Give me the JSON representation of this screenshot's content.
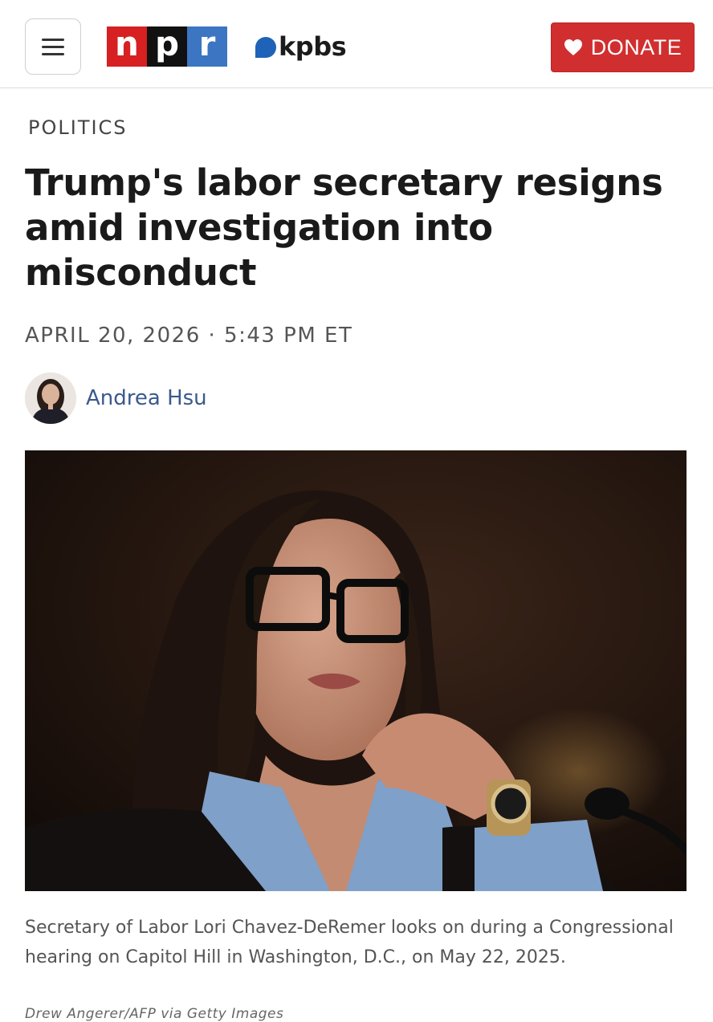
{
  "header": {
    "menu_icon": "hamburger-icon",
    "npr_logo": [
      "n",
      "p",
      "r"
    ],
    "station": "kpbs",
    "donate_label": "DONATE",
    "donate_icon": "heart-icon",
    "colors": {
      "npr_red": "#d62021",
      "npr_black": "#111111",
      "npr_blue": "#3c75c2",
      "donate_red": "#d12f2f",
      "kpbs_blue": "#1e63b8"
    }
  },
  "article": {
    "section": "POLITICS",
    "headline": "Trump's labor secretary resigns amid investigation into misconduct",
    "dateline": "APRIL 20, 2026 · 5:43 PM ET",
    "author": "Andrea Hsu",
    "caption": "Secretary of Labor Lori Chavez-DeRemer looks on during a Congressional hearing on Capitol Hill in Washington, D.C., on May 22, 2025.",
    "credit": "Drew Angerer/AFP via Getty Images"
  }
}
